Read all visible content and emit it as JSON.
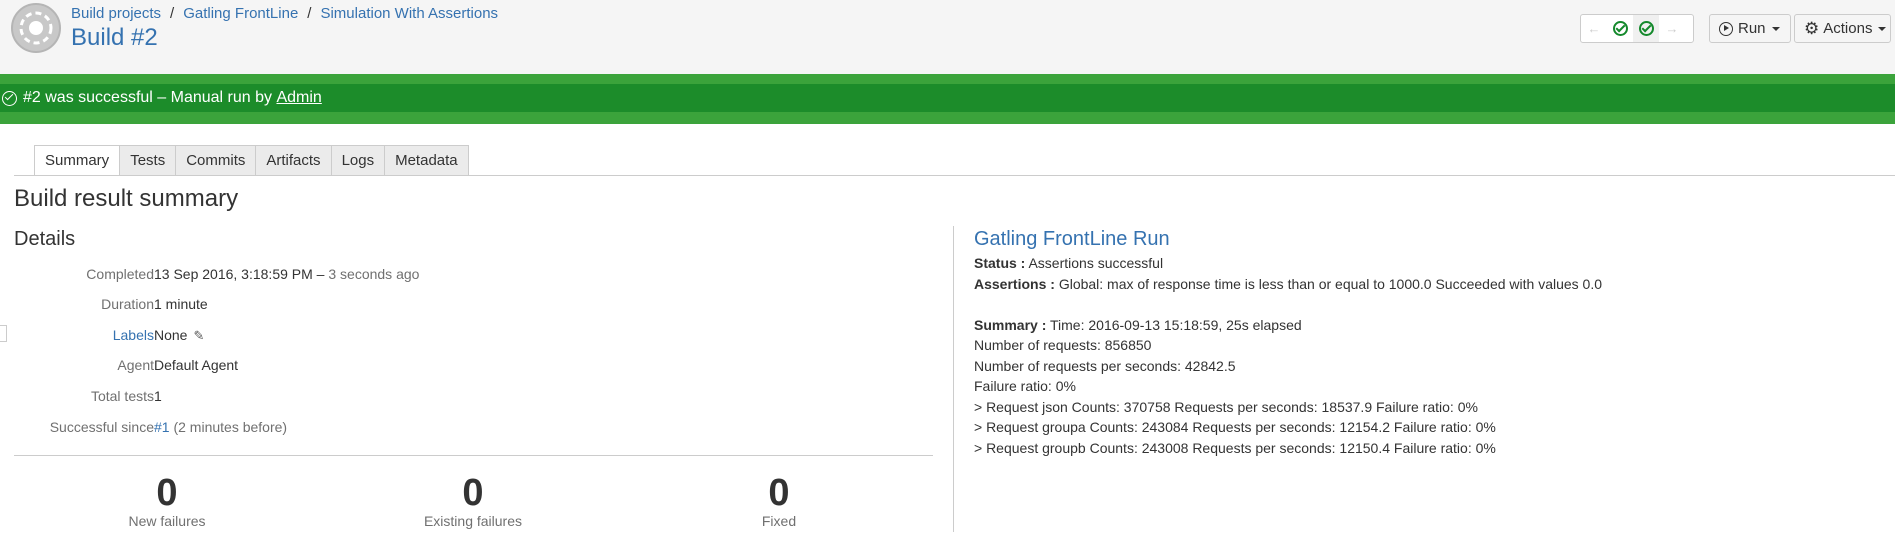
{
  "breadcrumb": {
    "items": [
      "Build projects",
      "Gatling FrontLine",
      "Simulation With Assertions"
    ],
    "separator": "/"
  },
  "page": {
    "title": "Build #2"
  },
  "toolbar": {
    "run_label": "Run",
    "actions_label": "Actions"
  },
  "banner": {
    "message": "#2 was successful – Manual run by",
    "user": "Admin",
    "color": "#1c8c2a"
  },
  "tabs": [
    "Summary",
    "Tests",
    "Commits",
    "Artifacts",
    "Logs",
    "Metadata"
  ],
  "summary": {
    "title": "Build result summary",
    "details_title": "Details",
    "details": {
      "completed_label": "Completed",
      "completed_value": "13 Sep 2016, 3:18:59 PM –",
      "completed_ago": "3 seconds ago",
      "duration_label": "Duration",
      "duration_value": "1 minute",
      "labels_label": "Labels",
      "labels_value": "None",
      "agent_label": "Agent",
      "agent_value": "Default Agent",
      "total_tests_label": "Total tests",
      "total_tests_value": "1",
      "successful_since_label": "Successful since",
      "successful_since_link": "#1",
      "successful_since_note": "(2 minutes before)"
    },
    "stats": [
      {
        "value": "0",
        "label": "New failures"
      },
      {
        "value": "0",
        "label": "Existing failures"
      },
      {
        "value": "0",
        "label": "Fixed"
      }
    ]
  },
  "frontline": {
    "title": "Gatling FrontLine Run",
    "status_label": "Status :",
    "status_value": "Assertions successful",
    "assertions_label": "Assertions :",
    "assertions_value": "Global: max of response time is less than or equal to 1000.0 Succeeded with values 0.0",
    "summary_label": "Summary :",
    "summary_value": "Time: 2016-09-13 15:18:59, 25s elapsed",
    "lines": [
      "Number of requests: 856850",
      "Number of requests per seconds: 42842.5",
      "Failure ratio: 0%",
      "> Request json Counts: 370758 Requests per seconds: 18537.9 Failure ratio: 0%",
      "> Request groupa Counts: 243084 Requests per seconds: 12154.2 Failure ratio: 0%",
      "> Request groupb Counts: 243008 Requests per seconds: 12150.4 Failure ratio: 0%"
    ]
  },
  "colors": {
    "link": "#3572b0",
    "success": "#14892c",
    "banner_outer": "#3ba33b"
  }
}
